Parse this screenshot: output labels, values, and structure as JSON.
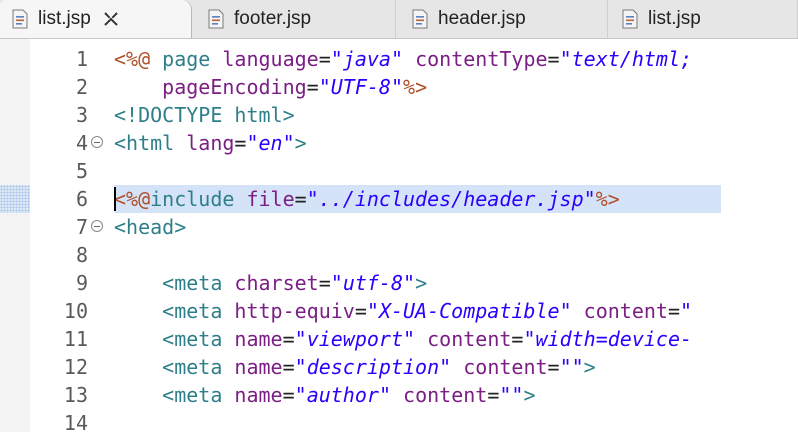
{
  "tabs": [
    {
      "label": "list.jsp",
      "active": true,
      "closable": true
    },
    {
      "label": "footer.jsp",
      "active": false
    },
    {
      "label": "header.jsp",
      "active": false
    },
    {
      "label": "list.jsp",
      "active": false
    }
  ],
  "icons": {
    "file": "jsp-file-icon",
    "close": "close-icon",
    "fold": "fold-collapse-icon"
  },
  "colors": {
    "directive": "#b0502b",
    "tag": "#2f7f8a",
    "attribute": "#7b1f85",
    "value": "#2a00ff",
    "highlight": "#d4e3f7"
  },
  "editor": {
    "highlighted_line": 6,
    "lines": [
      {
        "n": "1",
        "fold": false,
        "tokens": [
          [
            "d",
            "<%@ "
          ],
          [
            "t",
            "page "
          ],
          [
            "a",
            "language"
          ],
          [
            "eq",
            "="
          ],
          [
            "q",
            "\""
          ],
          [
            "v",
            "java"
          ],
          [
            "q",
            "\""
          ],
          [
            "eq",
            " "
          ],
          [
            "a",
            "contentType"
          ],
          [
            "eq",
            "="
          ],
          [
            "q",
            "\""
          ],
          [
            "v",
            "text/html;"
          ]
        ]
      },
      {
        "n": "2",
        "fold": false,
        "tokens": [
          [
            "eq",
            "    "
          ],
          [
            "a",
            "pageEncoding"
          ],
          [
            "eq",
            "="
          ],
          [
            "q",
            "\""
          ],
          [
            "v",
            "UTF-8"
          ],
          [
            "q",
            "\""
          ],
          [
            "d",
            "%>"
          ]
        ]
      },
      {
        "n": "3",
        "fold": false,
        "tokens": [
          [
            "dt",
            "<!DOCTYPE html>"
          ]
        ]
      },
      {
        "n": "4",
        "fold": true,
        "tokens": [
          [
            "t",
            "<html "
          ],
          [
            "a",
            "lang"
          ],
          [
            "eq",
            "="
          ],
          [
            "q",
            "\""
          ],
          [
            "v",
            "en"
          ],
          [
            "q",
            "\""
          ],
          [
            "t",
            ">"
          ]
        ]
      },
      {
        "n": "5",
        "fold": false,
        "tokens": []
      },
      {
        "n": "6",
        "fold": false,
        "tokens": [
          [
            "d",
            "<%@"
          ],
          [
            "t",
            "include "
          ],
          [
            "a",
            "file"
          ],
          [
            "eq",
            "="
          ],
          [
            "q",
            "\""
          ],
          [
            "v",
            "../includes/header.jsp"
          ],
          [
            "q",
            "\""
          ],
          [
            "d",
            "%>"
          ]
        ]
      },
      {
        "n": "7",
        "fold": true,
        "tokens": [
          [
            "t",
            "<head>"
          ]
        ]
      },
      {
        "n": "8",
        "fold": false,
        "tokens": []
      },
      {
        "n": "9",
        "fold": false,
        "tokens": [
          [
            "eq",
            "    "
          ],
          [
            "t",
            "<meta "
          ],
          [
            "a",
            "charset"
          ],
          [
            "eq",
            "="
          ],
          [
            "q",
            "\""
          ],
          [
            "v",
            "utf-8"
          ],
          [
            "q",
            "\""
          ],
          [
            "t",
            ">"
          ]
        ]
      },
      {
        "n": "10",
        "fold": false,
        "tokens": [
          [
            "eq",
            "    "
          ],
          [
            "t",
            "<meta "
          ],
          [
            "a",
            "http-equiv"
          ],
          [
            "eq",
            "="
          ],
          [
            "q",
            "\""
          ],
          [
            "v",
            "X-UA-Compatible"
          ],
          [
            "q",
            "\""
          ],
          [
            "eq",
            " "
          ],
          [
            "a",
            "content"
          ],
          [
            "eq",
            "="
          ],
          [
            "q",
            "\""
          ]
        ]
      },
      {
        "n": "11",
        "fold": false,
        "tokens": [
          [
            "eq",
            "    "
          ],
          [
            "t",
            "<meta "
          ],
          [
            "a",
            "name"
          ],
          [
            "eq",
            "="
          ],
          [
            "q",
            "\""
          ],
          [
            "v",
            "viewport"
          ],
          [
            "q",
            "\""
          ],
          [
            "eq",
            " "
          ],
          [
            "a",
            "content"
          ],
          [
            "eq",
            "="
          ],
          [
            "q",
            "\""
          ],
          [
            "v",
            "width=device-"
          ]
        ]
      },
      {
        "n": "12",
        "fold": false,
        "tokens": [
          [
            "eq",
            "    "
          ],
          [
            "t",
            "<meta "
          ],
          [
            "a",
            "name"
          ],
          [
            "eq",
            "="
          ],
          [
            "q",
            "\""
          ],
          [
            "v",
            "description"
          ],
          [
            "q",
            "\""
          ],
          [
            "eq",
            " "
          ],
          [
            "a",
            "content"
          ],
          [
            "eq",
            "="
          ],
          [
            "q",
            "\"\""
          ],
          [
            "t",
            ">"
          ]
        ]
      },
      {
        "n": "13",
        "fold": false,
        "tokens": [
          [
            "eq",
            "    "
          ],
          [
            "t",
            "<meta "
          ],
          [
            "a",
            "name"
          ],
          [
            "eq",
            "="
          ],
          [
            "q",
            "\""
          ],
          [
            "v",
            "author"
          ],
          [
            "q",
            "\""
          ],
          [
            "eq",
            " "
          ],
          [
            "a",
            "content"
          ],
          [
            "eq",
            "="
          ],
          [
            "q",
            "\"\""
          ],
          [
            "t",
            ">"
          ]
        ]
      },
      {
        "n": "14",
        "fold": false,
        "tokens": []
      }
    ]
  }
}
